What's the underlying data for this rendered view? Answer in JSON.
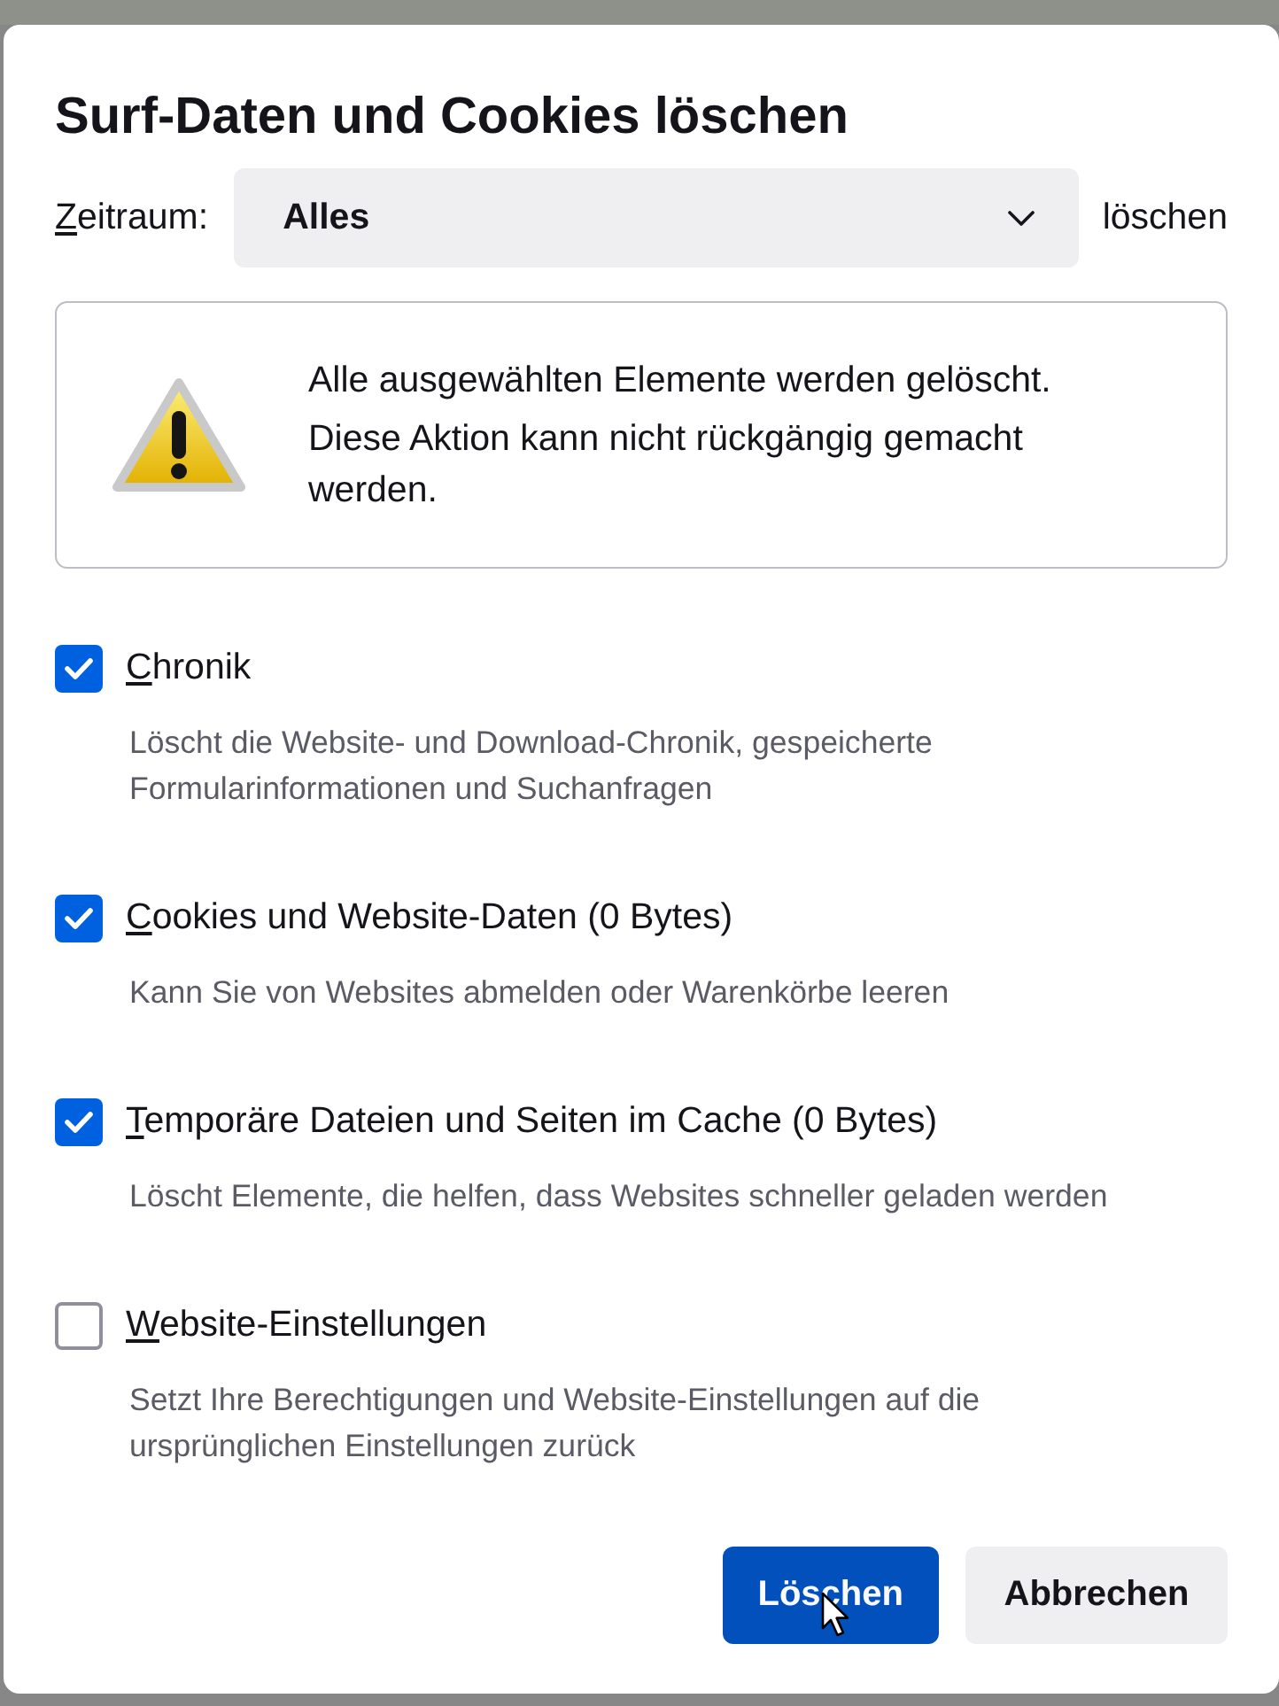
{
  "dialog": {
    "title": "Surf-Daten und Cookies löschen",
    "access_keys_shown": true
  },
  "time_range": {
    "label": "Zeitraum:",
    "value": "Alles",
    "suffix": "löschen"
  },
  "warning": {
    "lines": [
      "Alle ausgewählten Elemente werden gelöscht.",
      "Diese Aktion kann nicht rückgängig gemacht werden."
    ]
  },
  "options": [
    {
      "label": "Chronik",
      "description": "Löscht die Website- und Download-Chronik, gespeicherte Formularinformationen und Suchanfragen",
      "checked": true
    },
    {
      "label": "Cookies und Website-Daten (0 Bytes)",
      "description": "Kann Sie von Websites abmelden oder Warenkörbe leeren",
      "checked": true
    },
    {
      "label": "Temporäre Dateien und Seiten im Cache (0 Bytes)",
      "description": "Löscht Elemente, die helfen, dass Websites schneller geladen werden",
      "checked": true
    },
    {
      "label": "Website-Einstellungen",
      "description": "Setzt Ihre Berechtigungen und Website-Einstellungen auf die ursprünglichen Einstellungen zurück",
      "checked": false
    }
  ],
  "buttons": [
    {
      "label": "Löschen",
      "kind": "primary",
      "hovered": true
    },
    {
      "label": "Abbrechen",
      "kind": "secondary",
      "hovered": false
    }
  ]
}
